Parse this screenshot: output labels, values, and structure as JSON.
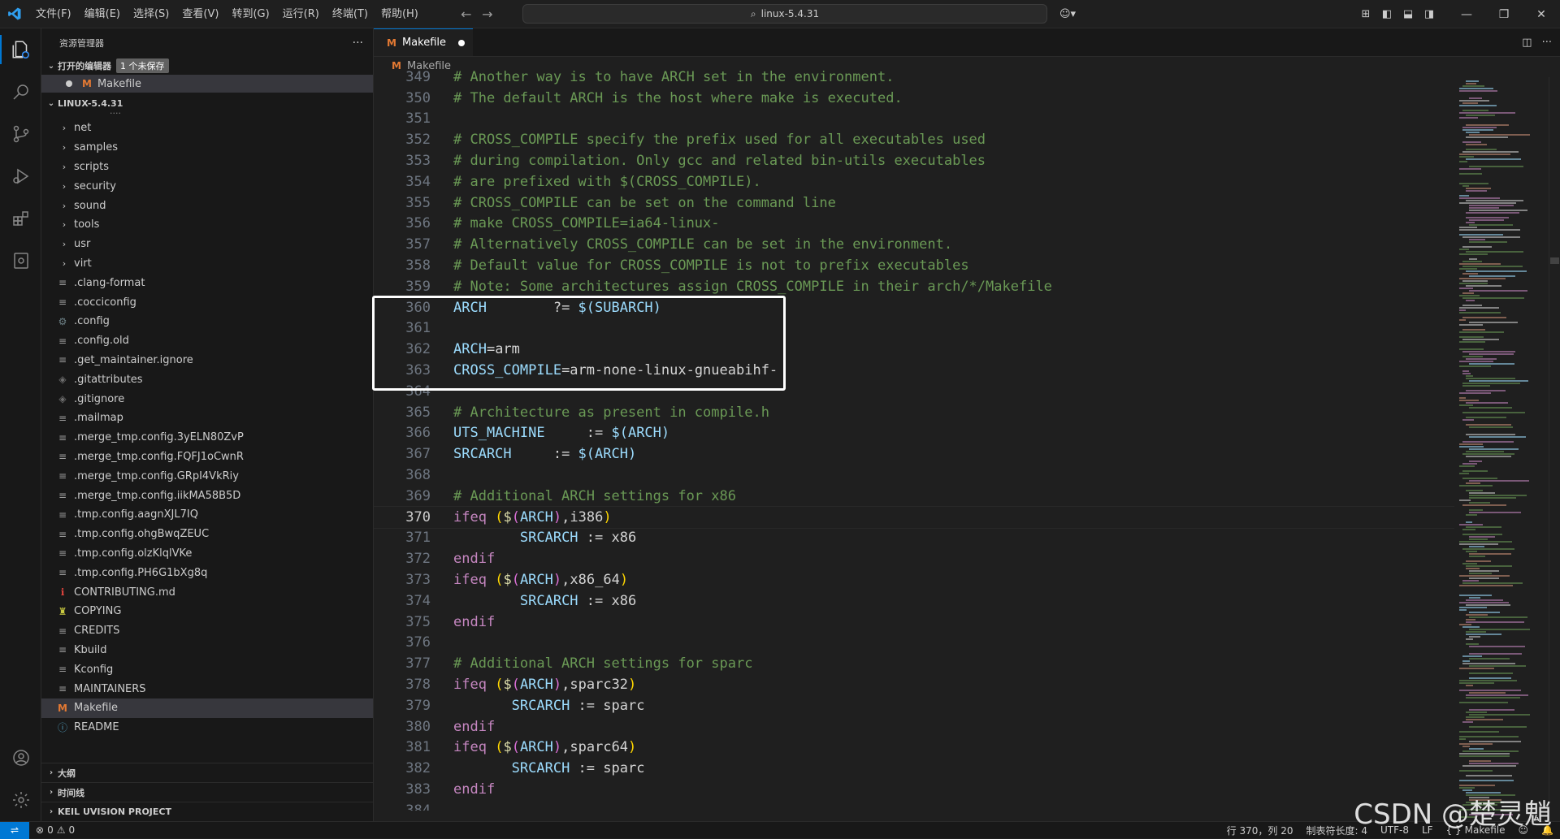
{
  "menu": [
    "文件(F)",
    "编辑(E)",
    "选择(S)",
    "查看(V)",
    "转到(G)",
    "运行(R)",
    "终端(T)",
    "帮助(H)"
  ],
  "search": {
    "label": "linux-5.4.31"
  },
  "sidebar": {
    "title": "资源管理器",
    "open_editors": {
      "label": "打开的编辑器",
      "badge": "1 个未保存",
      "file": "Makefile"
    },
    "project": "LINUX-5.4.31",
    "folders": [
      "net",
      "samples",
      "scripts",
      "security",
      "sound",
      "tools",
      "usr",
      "virt"
    ],
    "files": [
      {
        "name": ".clang-format",
        "icon": "lines"
      },
      {
        "name": ".cocciconfig",
        "icon": "lines"
      },
      {
        "name": ".config",
        "icon": "gear"
      },
      {
        "name": ".config.old",
        "icon": "lines"
      },
      {
        "name": ".get_maintainer.ignore",
        "icon": "lines"
      },
      {
        "name": ".gitattributes",
        "icon": "git"
      },
      {
        "name": ".gitignore",
        "icon": "git"
      },
      {
        "name": ".mailmap",
        "icon": "lines"
      },
      {
        "name": ".merge_tmp.config.3yELN80ZvP",
        "icon": "lines"
      },
      {
        "name": ".merge_tmp.config.FQFJ1oCwnR",
        "icon": "lines"
      },
      {
        "name": ".merge_tmp.config.GRpI4VkRiy",
        "icon": "lines"
      },
      {
        "name": ".merge_tmp.config.iikMA58B5D",
        "icon": "lines"
      },
      {
        "name": ".tmp.config.aagnXJL7IQ",
        "icon": "lines"
      },
      {
        "name": ".tmp.config.ohgBwqZEUC",
        "icon": "lines"
      },
      {
        "name": ".tmp.config.olzKlqlVKe",
        "icon": "lines"
      },
      {
        "name": ".tmp.config.PH6G1bXg8q",
        "icon": "lines"
      },
      {
        "name": "CONTRIBUTING.md",
        "icon": "md"
      },
      {
        "name": "COPYING",
        "icon": "license"
      },
      {
        "name": "CREDITS",
        "icon": "lines"
      },
      {
        "name": "Kbuild",
        "icon": "lines"
      },
      {
        "name": "Kconfig",
        "icon": "lines"
      },
      {
        "name": "MAINTAINERS",
        "icon": "lines"
      },
      {
        "name": "Makefile",
        "icon": "makefile"
      },
      {
        "name": "README",
        "icon": "info"
      }
    ],
    "bottom_sections": [
      "大纲",
      "时间线",
      "KEIL UVISION PROJECT"
    ]
  },
  "tab": {
    "label": "Makefile"
  },
  "breadcrumb": {
    "file": "Makefile"
  },
  "code": [
    {
      "n": "349",
      "t": "comment",
      "s": "# Another way is to have ARCH set in the environment."
    },
    {
      "n": "350",
      "t": "comment",
      "s": "# The default ARCH is the host where make is executed."
    },
    {
      "n": "351",
      "t": "blank",
      "s": ""
    },
    {
      "n": "352",
      "t": "comment",
      "s": "# CROSS_COMPILE specify the prefix used for all executables used"
    },
    {
      "n": "353",
      "t": "comment",
      "s": "# during compilation. Only gcc and related bin-utils executables"
    },
    {
      "n": "354",
      "t": "comment",
      "s": "# are prefixed with $(CROSS_COMPILE)."
    },
    {
      "n": "355",
      "t": "comment",
      "s": "# CROSS_COMPILE can be set on the command line"
    },
    {
      "n": "356",
      "t": "comment",
      "s": "# make CROSS_COMPILE=ia64-linux-"
    },
    {
      "n": "357",
      "t": "comment",
      "s": "# Alternatively CROSS_COMPILE can be set in the environment."
    },
    {
      "n": "358",
      "t": "comment",
      "s": "# Default value for CROSS_COMPILE is not to prefix executables"
    },
    {
      "n": "359",
      "t": "comment",
      "s": "# Note: Some architectures assign CROSS_COMPILE in their arch/*/Makefile"
    },
    {
      "n": "360",
      "t": "assign",
      "a": "ARCH",
      "b": "        ?= ",
      "c": "$(SUBARCH)"
    },
    {
      "n": "361",
      "t": "blank",
      "s": ""
    },
    {
      "n": "362",
      "t": "assign",
      "a": "ARCH",
      "b": "=arm",
      "c": ""
    },
    {
      "n": "363",
      "t": "assign",
      "a": "CROSS_COMPILE",
      "b": "=arm-none-linux-gnueabihf-",
      "c": ""
    },
    {
      "n": "364",
      "t": "blank",
      "s": ""
    },
    {
      "n": "365",
      "t": "comment",
      "s": "# Architecture as present in compile.h"
    },
    {
      "n": "366",
      "t": "assign",
      "a": "UTS_MACHINE",
      "b": "     := ",
      "c": "$(ARCH)"
    },
    {
      "n": "367",
      "t": "assign",
      "a": "SRCARCH",
      "b": "     := ",
      "c": "$(ARCH)"
    },
    {
      "n": "368",
      "t": "blank",
      "s": ""
    },
    {
      "n": "369",
      "t": "comment",
      "s": "# Additional ARCH settings for x86"
    },
    {
      "n": "370",
      "t": "ifeq",
      "s": "i386",
      "cur": true
    },
    {
      "n": "371",
      "t": "inner",
      "a": "SRCARCH",
      "b": " := x86"
    },
    {
      "n": "372",
      "t": "kw",
      "s": "endif"
    },
    {
      "n": "373",
      "t": "ifeq",
      "s": "x86_64"
    },
    {
      "n": "374",
      "t": "inner",
      "a": "SRCARCH",
      "b": " := x86"
    },
    {
      "n": "375",
      "t": "kw",
      "s": "endif"
    },
    {
      "n": "376",
      "t": "blank",
      "s": ""
    },
    {
      "n": "377",
      "t": "comment",
      "s": "# Additional ARCH settings for sparc"
    },
    {
      "n": "378",
      "t": "ifeq",
      "s": "sparc32"
    },
    {
      "n": "379",
      "t": "inner2",
      "a": "SRCARCH",
      "b": " := sparc"
    },
    {
      "n": "380",
      "t": "kw",
      "s": "endif"
    },
    {
      "n": "381",
      "t": "ifeq",
      "s": "sparc64"
    },
    {
      "n": "382",
      "t": "inner2",
      "a": "SRCARCH",
      "b": " := sparc"
    },
    {
      "n": "383",
      "t": "kw",
      "s": "endif"
    },
    {
      "n": "384",
      "t": "blank",
      "s": ""
    }
  ],
  "status": {
    "errors": "0",
    "warnings": "0",
    "position": "行 370，列 20",
    "tab_size": "制表符长度: 4",
    "encoding": "UTF-8",
    "eol": "LF",
    "language": "Makefile"
  },
  "watermark": "CSDN @楚灵魈",
  "colors": {
    "accent": "#0078d4",
    "comment": "#6a9955",
    "variable": "#9cdcfe",
    "keyword": "#c586c0",
    "makefile_icon": "#e37933"
  }
}
